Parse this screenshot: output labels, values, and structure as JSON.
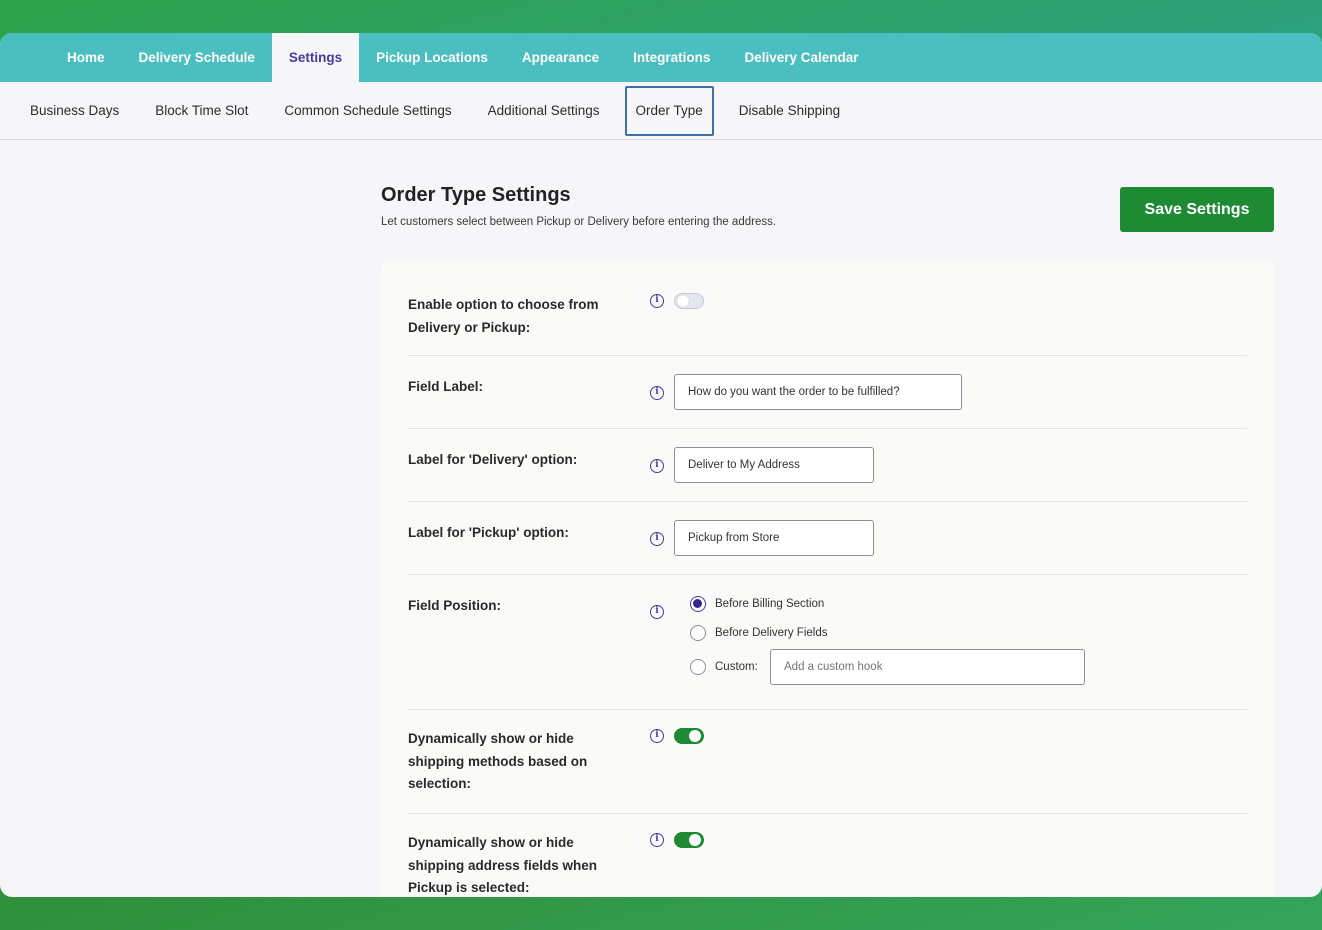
{
  "top_nav": {
    "tabs": [
      "Home",
      "Delivery Schedule",
      "Settings",
      "Pickup Locations",
      "Appearance",
      "Integrations",
      "Delivery Calendar"
    ],
    "active": "Settings"
  },
  "sub_nav": {
    "tabs": [
      "Business Days",
      "Block Time Slot",
      "Common Schedule Settings",
      "Additional Settings",
      "Order Type",
      "Disable Shipping"
    ],
    "active": "Order Type"
  },
  "page": {
    "title": "Order Type Settings",
    "description": "Let customers select between Pickup or Delivery before entering the address.",
    "save_label": "Save Settings"
  },
  "settings": {
    "enable_choice": {
      "label": "Enable option to choose from Delivery or Pickup:",
      "enabled": false
    },
    "field_label": {
      "label": "Field Label:",
      "value": "How do you want the order to be fulfilled?"
    },
    "delivery_label": {
      "label": "Label for 'Delivery' option:",
      "value": "Deliver to My Address"
    },
    "pickup_label": {
      "label": "Label for 'Pickup' option:",
      "value": "Pickup from Store"
    },
    "field_position": {
      "label": "Field Position:",
      "options": [
        "Before Billing Section",
        "Before Delivery Fields",
        "Custom:"
      ],
      "selected": "Before Billing Section",
      "custom_placeholder": "Add a custom hook"
    },
    "dynamic_shipping_methods": {
      "label": "Dynamically show or hide shipping methods based on selection:",
      "enabled": true
    },
    "dynamic_address_fields": {
      "label": "Dynamically show or hide shipping address fields when Pickup is selected:",
      "enabled": true
    }
  },
  "colors": {
    "nav_bg": "#4bbfbf",
    "accent_purple": "#4a3a9c",
    "save_green": "#1e8a34",
    "toggle_on": "#1e8a34"
  },
  "icons": {
    "info": "info-icon"
  }
}
